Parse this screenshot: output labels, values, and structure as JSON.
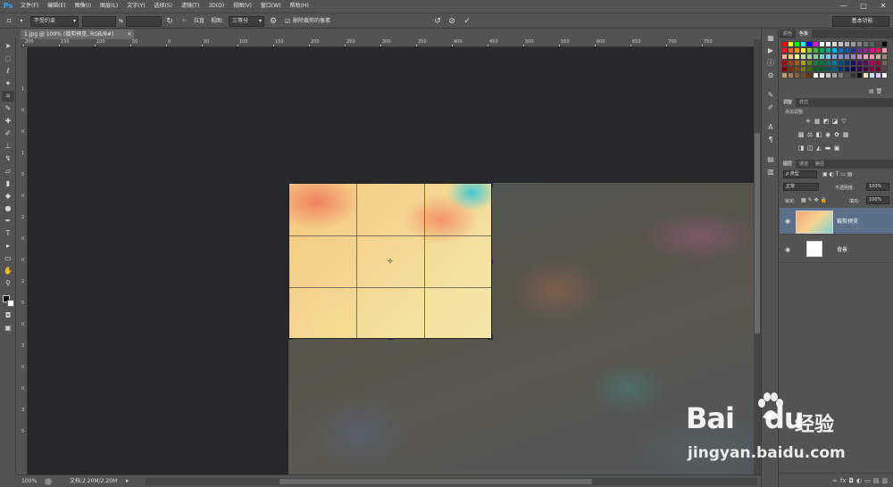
{
  "app": {
    "logo": "Ps"
  },
  "menu": [
    "文件(F)",
    "编辑(E)",
    "图像(I)",
    "图层(L)",
    "文字(Y)",
    "选择(S)",
    "滤镜(T)",
    "3D(D)",
    "视图(V)",
    "窗口(W)",
    "帮助(H)"
  ],
  "window_controls": {
    "minimize": "—",
    "maximize": "□",
    "close": "✕"
  },
  "options": {
    "ratio_value": "不受约束",
    "swap_symbol": "⇆",
    "straighten_label": "拉直",
    "view_label": "视图:",
    "view_value": "三等分",
    "delete_cropped_label": "删除裁剪的像素",
    "workspace": "基本功能"
  },
  "document": {
    "tab_title": "1.jpg @ 100% (裁剪预览, RGB/8#)",
    "ruler_top_labels": [
      "200",
      "150",
      "100",
      "50",
      "0",
      "50",
      "100",
      "150",
      "200",
      "250",
      "300",
      "350",
      "400",
      "450",
      "500",
      "550",
      "600",
      "650",
      "700",
      "750"
    ],
    "ruler_left_labels": [
      "1",
      "0",
      "0",
      "1",
      "5",
      "0",
      "2",
      "0",
      "0",
      "2",
      "5",
      "0",
      "3",
      "0",
      "0",
      "3",
      "5"
    ]
  },
  "status": {
    "zoom": "100%",
    "doc_size": "文档:2.20M/2.20M"
  },
  "panels": {
    "color_tabs": [
      "颜色",
      "色板"
    ],
    "adjust_tabs": [
      "调整",
      "样式"
    ],
    "adjust_title": "添加调整",
    "layers_tabs": [
      "图层",
      "通道",
      "路径"
    ],
    "kind_label": "ρ 类型",
    "blend_mode": "正常",
    "opacity_label": "不透明度:",
    "opacity_value": "100%",
    "lock_label": "锁定:",
    "fill_label": "填充:",
    "fill_value": "100%",
    "layers": [
      {
        "name": "裁剪预览",
        "selected": true
      },
      {
        "name": "背景",
        "selected": false
      }
    ]
  },
  "watermark": {
    "brand": "Bai",
    "brand2": "du",
    "cn": "经验",
    "url": "jingyan.baidu.com"
  },
  "swatch_colors": [
    "#ff0000",
    "#ffff00",
    "#00ff00",
    "#00ffff",
    "#0000ff",
    "#ff00ff",
    "#ffffff",
    "#ebebeb",
    "#d6d6d6",
    "#c2c2c2",
    "#adadad",
    "#999999",
    "#858585",
    "#707070",
    "#5c5c5c",
    "#474747",
    "#000000",
    "#ed1c24",
    "#f26522",
    "#f7941d",
    "#fff200",
    "#8dc63f",
    "#39b54a",
    "#00a651",
    "#00a99d",
    "#00aeef",
    "#0072bc",
    "#0054a6",
    "#2e3192",
    "#662d91",
    "#92278f",
    "#ec008c",
    "#ed145b",
    "#f6989d",
    "#f9ad81",
    "#fdc68a",
    "#fff799",
    "#c4df9b",
    "#a3d39c",
    "#82ca9c",
    "#7accc8",
    "#6dcff6",
    "#7da7d9",
    "#8393ca",
    "#8781bd",
    "#a187be",
    "#bd8cbf",
    "#f49ac1",
    "#f5989d",
    "#c7b299",
    "#998675",
    "#9e0b0f",
    "#a0410d",
    "#a36209",
    "#aba000",
    "#598527",
    "#1a7b30",
    "#007236",
    "#00746b",
    "#0076a3",
    "#004b80",
    "#003471",
    "#1b1464",
    "#440e62",
    "#630460",
    "#9e005d",
    "#9e0039",
    "#736357",
    "#790000",
    "#7b2e00",
    "#7d4900",
    "#827b00",
    "#406618",
    "#005e20",
    "#005826",
    "#005952",
    "#005b7f",
    "#003663",
    "#002157",
    "#0d004c",
    "#32004b",
    "#4b0049",
    "#7b0046",
    "#7a0026",
    "#534741",
    "#c69c6d",
    "#a67c52",
    "#8c6239",
    "#754c24",
    "#603913",
    "#ffffff",
    "#e8e8e8",
    "#c8c8c8",
    "#a0a0a0",
    "#787878",
    "#505050",
    "#303030",
    "#101010",
    "#ffe0c0",
    "#c0e0ff",
    "#e0c0ff",
    "#ffffff"
  ]
}
